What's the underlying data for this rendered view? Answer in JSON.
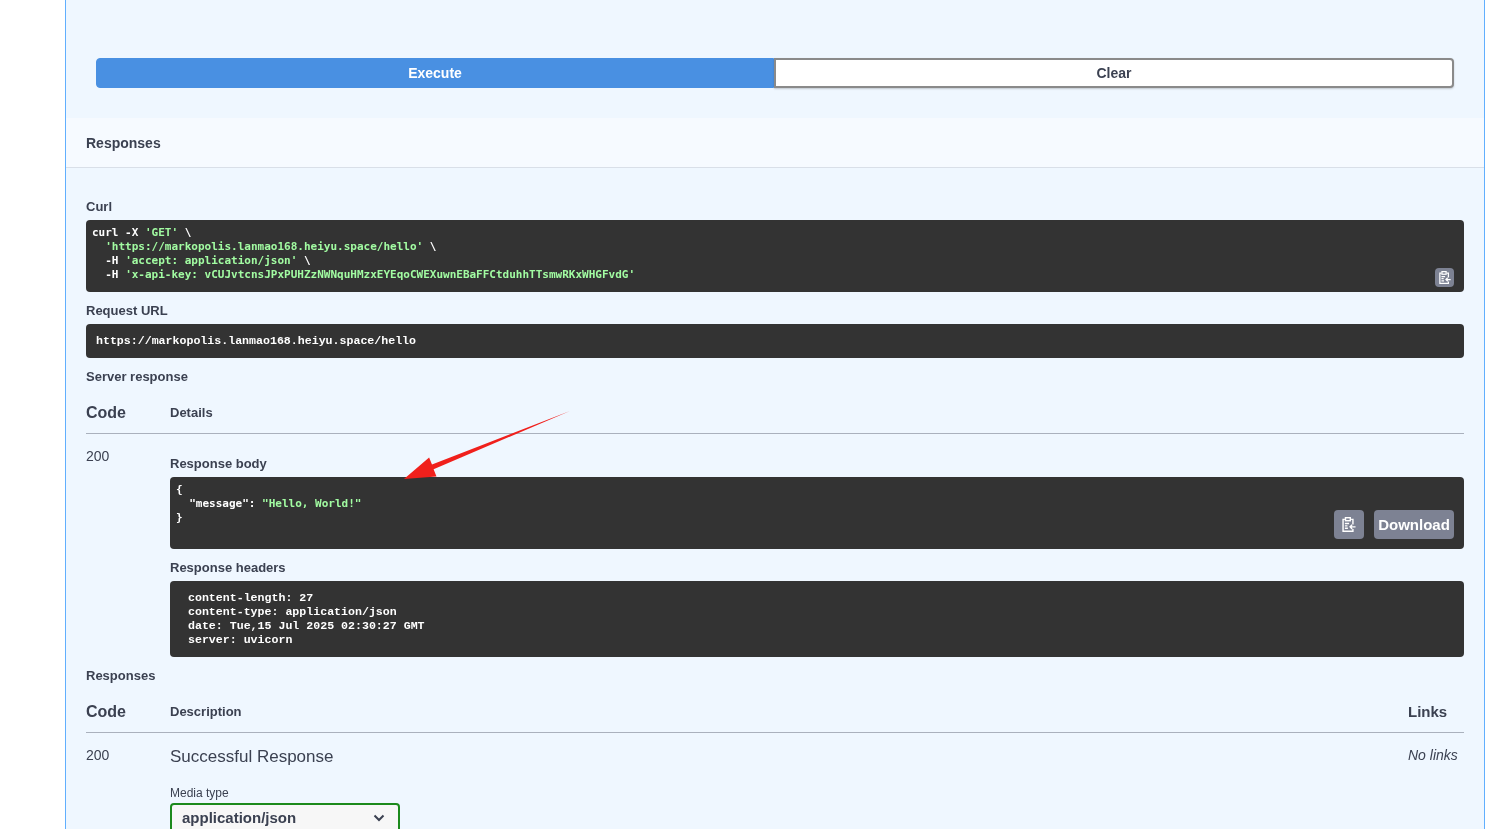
{
  "actions": [
    {
      "label": "Execute",
      "kind": "primary"
    },
    {
      "label": "Clear",
      "kind": "secondary"
    }
  ],
  "responses_bar": {
    "title": "Responses"
  },
  "curl": {
    "label": "Curl",
    "lines": [
      [
        {
          "text": "curl -X ",
          "kind": "plain"
        },
        {
          "text": "'GET'",
          "kind": "string"
        },
        {
          "text": " \\",
          "kind": "plain"
        }
      ],
      [
        {
          "text": "  'https://markopolis.lanmao168.heiyu.space/hello'",
          "kind": "string"
        },
        {
          "text": " \\",
          "kind": "plain"
        }
      ],
      [
        {
          "text": "  -H ",
          "kind": "plain"
        },
        {
          "text": "'accept: application/json'",
          "kind": "string"
        },
        {
          "text": " \\",
          "kind": "plain"
        }
      ],
      [
        {
          "text": "  -H ",
          "kind": "plain"
        },
        {
          "text": "'x-api-key: vCUJvtcnsJPxPUHZzNWNquHMzxEYEqoCWEXuwnEBaFFCtduhhTTsmwRKxWHGFvdG'",
          "kind": "string"
        }
      ]
    ]
  },
  "request_url": {
    "label": "Request URL",
    "value": "https://markopolis.lanmao168.heiyu.space/hello"
  },
  "server_response": {
    "title": "Server response",
    "columns": [
      {
        "label": "Code",
        "kind": "code"
      },
      {
        "label": "Details",
        "kind": "main"
      }
    ],
    "rows": [
      {
        "code": "200",
        "body_label": "Response body",
        "body_lines": [
          [
            {
              "text": "{",
              "kind": "plain"
            }
          ],
          [
            {
              "text": "  \"message\": ",
              "kind": "plain"
            },
            {
              "text": "\"Hello, World!\"",
              "kind": "string"
            }
          ],
          [
            {
              "text": "}",
              "kind": "plain"
            }
          ]
        ],
        "download_label": "Download",
        "headers_label": "Response headers",
        "headers": [
          "content-length: 27",
          "content-type: application/json",
          "date: Tue,15 Jul 2025 02:30:27 GMT",
          "server: uvicorn"
        ]
      }
    ]
  },
  "responses": {
    "title": "Responses",
    "columns": [
      {
        "label": "Code",
        "kind": "code"
      },
      {
        "label": "Description",
        "kind": "main"
      },
      {
        "label": "Links",
        "kind": "links"
      }
    ],
    "rows": [
      {
        "code": "200",
        "description": "Successful Response",
        "links": "No links",
        "media_type_label": "Media type",
        "media_type": "application/json"
      }
    ]
  }
}
